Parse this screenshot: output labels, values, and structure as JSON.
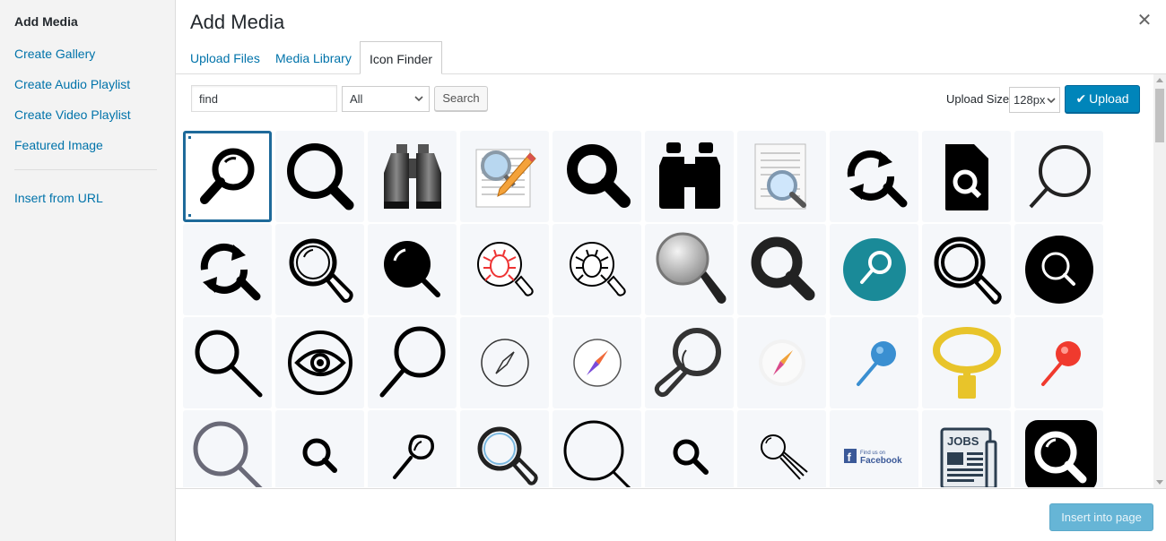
{
  "sidebar": {
    "title": "Add Media",
    "items": [
      {
        "label": "Create Gallery"
      },
      {
        "label": "Create Audio Playlist"
      },
      {
        "label": "Create Video Playlist"
      },
      {
        "label": "Featured Image"
      },
      {
        "label": "Insert from URL"
      }
    ]
  },
  "frame": {
    "title": "Add Media",
    "close_icon": "close-icon"
  },
  "tabs": [
    {
      "label": "Upload Files",
      "active": false
    },
    {
      "label": "Media Library",
      "active": false
    },
    {
      "label": "Icon Finder",
      "active": true
    }
  ],
  "toolbar": {
    "search_value": "find",
    "filter_selected": "All",
    "search_button": "Search",
    "upload_size_label": "Upload Size:",
    "upload_size_selected": "128px",
    "upload_button": "Upload"
  },
  "footer": {
    "insert_button": "Insert into page"
  },
  "colors": {
    "primary": "#0085ba",
    "link": "#0073aa",
    "teal": "#1a8a98",
    "pin_blue": "#3a8fd1",
    "pin_red": "#f03a2e",
    "gold": "#e8c42a"
  },
  "icons": [
    "magnifier-icon",
    "magnifier-bold-icon",
    "binoculars-icon",
    "document-edit-search-icon",
    "magnifier-heavy-icon",
    "binoculars-solid-icon",
    "document-magnifier-icon",
    "refresh-search-icon",
    "file-search-icon",
    "magnifier-thin-icon",
    "refresh-search-icon",
    "magnifier-outline-icon",
    "magnifier-filled-icon",
    "bug-search-red-icon",
    "bug-search-icon",
    "magnifier-3d-icon",
    "magnifier-dark-icon",
    "teal-circle-search-icon",
    "magnifier-double-outline-icon",
    "black-circle-search-icon",
    "magnifier-left-icon",
    "eye-circle-icon",
    "magnifier-large-icon",
    "compass-icon",
    "compass-color-icon",
    "magnifier-heavy-outline-icon",
    "compass-glossy-icon",
    "blue-pin-icon",
    "gold-magnifier-icon",
    "red-pin-icon",
    "magnifier-gray-icon",
    "magnifier-small-icon",
    "magnifier-sketch-icon",
    "magnifier-blue-ring-icon",
    "magnifier-huge-icon",
    "magnifier-tiny-icon",
    "magnifier-lines-icon",
    "facebook-find-us-icon",
    "jobs-newspaper-icon",
    "magnifier-black-square-icon"
  ],
  "facebook_badge": {
    "line1": "Find us on",
    "line2": "Facebook"
  },
  "jobs_badge": {
    "text": "JOBS"
  }
}
